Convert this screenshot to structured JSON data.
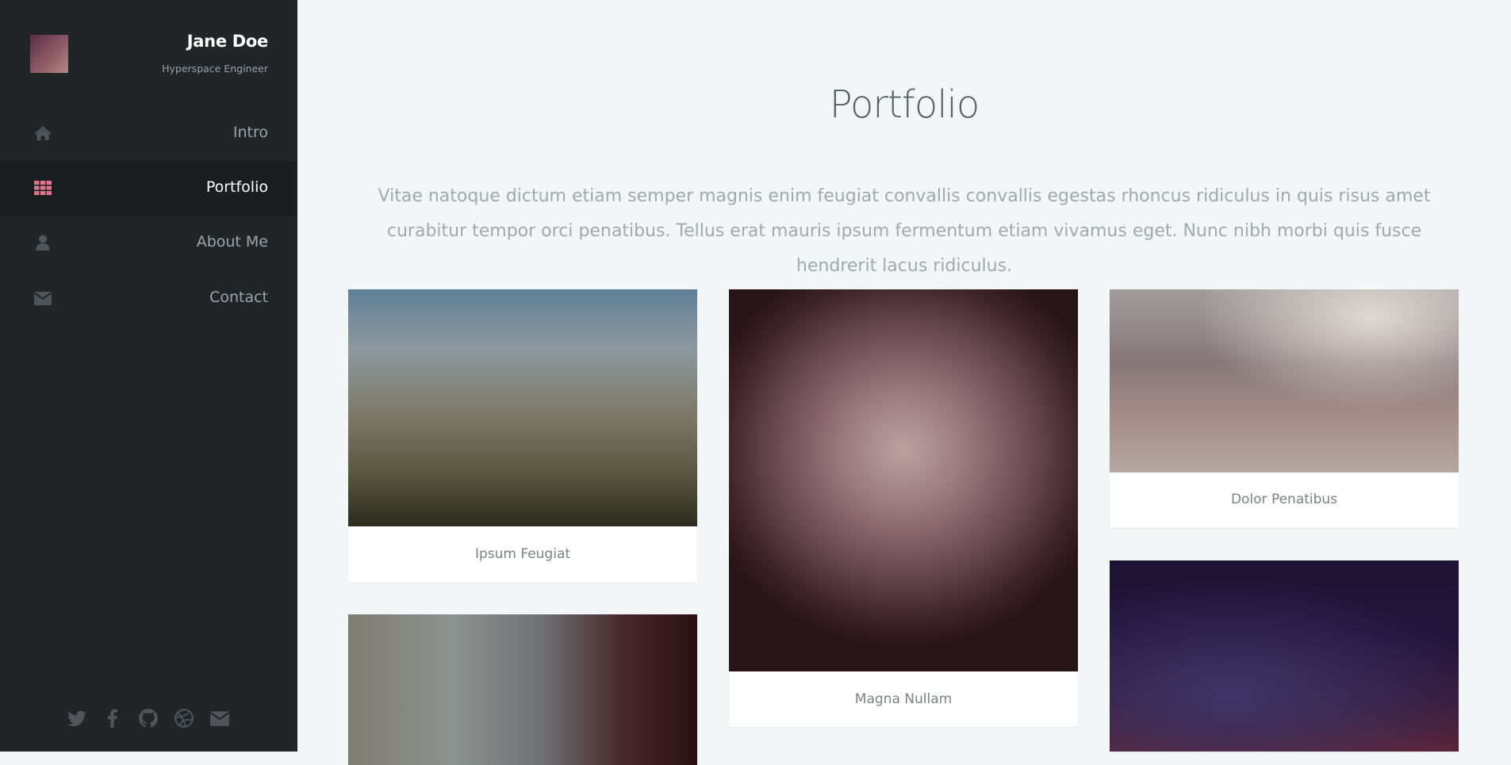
{
  "profile": {
    "name": "Jane Doe",
    "role": "Hyperspace Engineer"
  },
  "nav": {
    "items": [
      {
        "label": "Intro",
        "icon": "home-icon",
        "active": false
      },
      {
        "label": "Portfolio",
        "icon": "grid-icon",
        "active": true
      },
      {
        "label": "About Me",
        "icon": "user-icon",
        "active": false
      },
      {
        "label": "Contact",
        "icon": "envelope-icon",
        "active": false
      }
    ]
  },
  "social": [
    "twitter-icon",
    "facebook-icon",
    "github-icon",
    "dribbble-icon",
    "email-icon"
  ],
  "main": {
    "title": "Portfolio",
    "intro": "Vitae natoque dictum etiam semper magnis enim feugiat convallis convallis egestas rhoncus ridiculus in quis risus amet curabitur tempor orci penatibus. Tellus erat mauris ipsum fermentum etiam vivamus eget. Nunc nibh morbi quis fusce hendrerit lacus ridiculus."
  },
  "portfolio": [
    {
      "caption": "Ipsum Feugiat"
    },
    {
      "caption": "Magna Nullam"
    },
    {
      "caption": "Dolor Penatibus"
    },
    {
      "caption": ""
    },
    {
      "caption": ""
    }
  ],
  "colors": {
    "sidebar_bg": "#212528",
    "active_bg": "#1b1e21",
    "accent": "#e27689",
    "page_bg": "#f2f6f6"
  }
}
